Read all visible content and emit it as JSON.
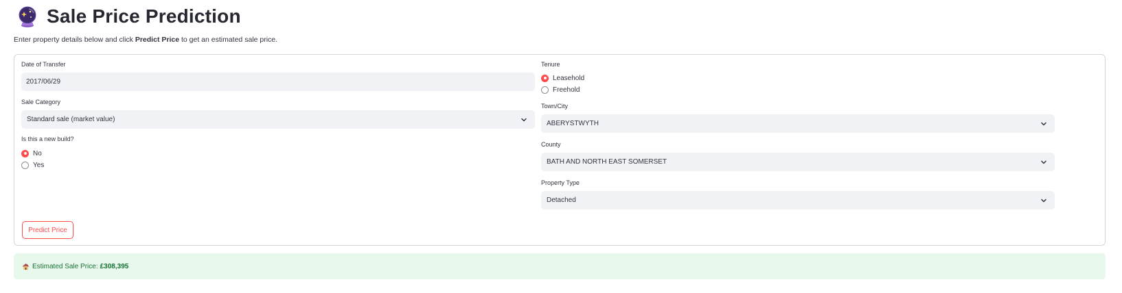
{
  "header": {
    "icon": "crystal-ball-icon",
    "title": "Sale Price Prediction"
  },
  "intro": {
    "before": "Enter property details below and click ",
    "emphasis": "Predict Price",
    "after": " to get an estimated sale price."
  },
  "form": {
    "date_of_transfer": {
      "label": "Date of Transfer",
      "value": "2017/06/29"
    },
    "sale_category": {
      "label": "Sale Category",
      "selected": "Standard sale (market value)"
    },
    "new_build": {
      "label": "Is this a new build?",
      "options": [
        "No",
        "Yes"
      ],
      "selected": "No"
    },
    "tenure": {
      "label": "Tenure",
      "options": [
        "Leasehold",
        "Freehold"
      ],
      "selected": "Leasehold"
    },
    "town_city": {
      "label": "Town/City",
      "selected": "ABERYSTWYTH"
    },
    "county": {
      "label": "County",
      "selected": "BATH AND NORTH EAST SOMERSET"
    },
    "property_type": {
      "label": "Property Type",
      "selected": "Detached"
    },
    "submit_label": "Predict Price"
  },
  "result": {
    "icon": "house-icon",
    "label": "Estimated Sale Price:",
    "value": "£308,395"
  },
  "colors": {
    "accent": "#ff4b4b",
    "input_bg": "#f0f2f6",
    "success_bg": "#e8f8ec",
    "success_text": "#177233"
  }
}
